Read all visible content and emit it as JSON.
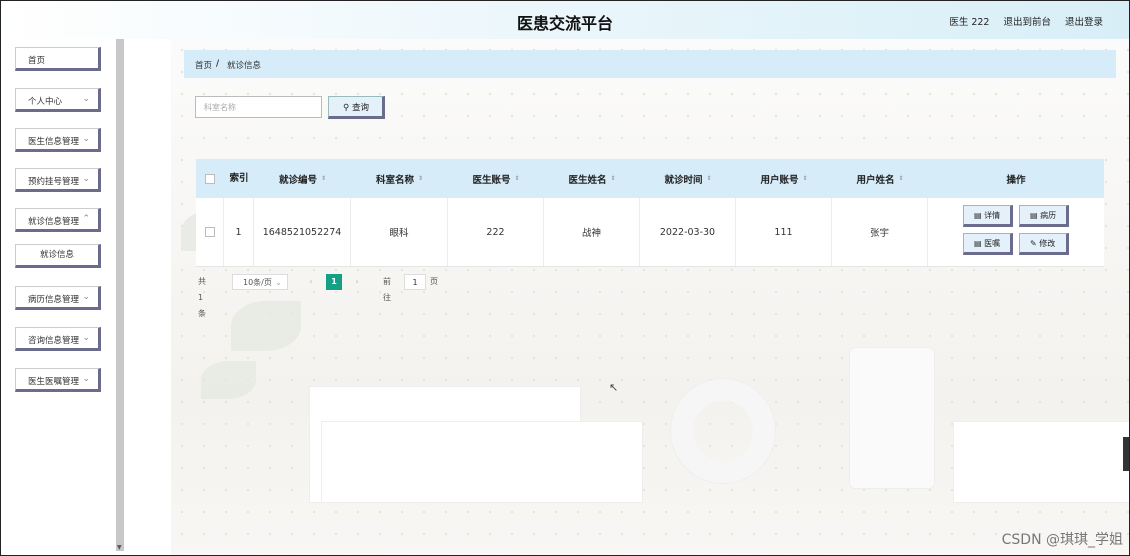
{
  "header": {
    "title": "医患交流平台",
    "user": "医生 222",
    "back_to_front": "退出到前台",
    "logout": "退出登录"
  },
  "sidebar": {
    "items": [
      {
        "label": "首页",
        "chevron": ""
      },
      {
        "label": "个人中心",
        "chevron": "⌄"
      },
      {
        "label": "医生信息管理",
        "chevron": "⌄"
      },
      {
        "label": "预约挂号管理",
        "chevron": "⌄"
      },
      {
        "label": "就诊信息管理",
        "chevron": "⌃"
      },
      {
        "label": "病历信息管理",
        "chevron": "⌄"
      },
      {
        "label": "咨询信息管理",
        "chevron": "⌄"
      },
      {
        "label": "医生医嘱管理",
        "chevron": "⌄"
      }
    ],
    "submenu": {
      "label": "就诊信息"
    }
  },
  "breadcrumb": {
    "home": "首页",
    "separator": "/",
    "current": "就诊信息"
  },
  "search": {
    "placeholder": "科室名称",
    "button": "查询",
    "icon": "search-icon"
  },
  "table": {
    "columns": [
      {
        "label": "",
        "sort": ""
      },
      {
        "label": "索引",
        "sort": ""
      },
      {
        "label": "就诊编号",
        "sort": "⇕"
      },
      {
        "label": "科室名称",
        "sort": "⇕"
      },
      {
        "label": "医生账号",
        "sort": "⇕"
      },
      {
        "label": "医生姓名",
        "sort": "⇕"
      },
      {
        "label": "就诊时间",
        "sort": "⇕"
      },
      {
        "label": "用户账号",
        "sort": "⇕"
      },
      {
        "label": "用户姓名",
        "sort": "⇕"
      },
      {
        "label": "操作",
        "sort": ""
      }
    ],
    "rows": [
      {
        "index": "1",
        "visit_no": "1648521052274",
        "dept": "眼科",
        "doctor_account": "222",
        "doctor_name": "战神",
        "visit_time": "2022-03-30",
        "user_account": "111",
        "user_name": "张宇"
      }
    ],
    "actions": {
      "detail": "详情",
      "record": "病历",
      "advice": "医嘱",
      "edit": "修改",
      "doc_icon": "▤",
      "edit_icon": "✎"
    }
  },
  "pagination": {
    "total": "共 1 条",
    "page_size": "10条/页",
    "prev": "‹",
    "current": "1",
    "next": "›",
    "goto": "前往",
    "goto_value": "1",
    "page_suffix": "页"
  },
  "watermark": "CSDN @琪琪_学姐"
}
